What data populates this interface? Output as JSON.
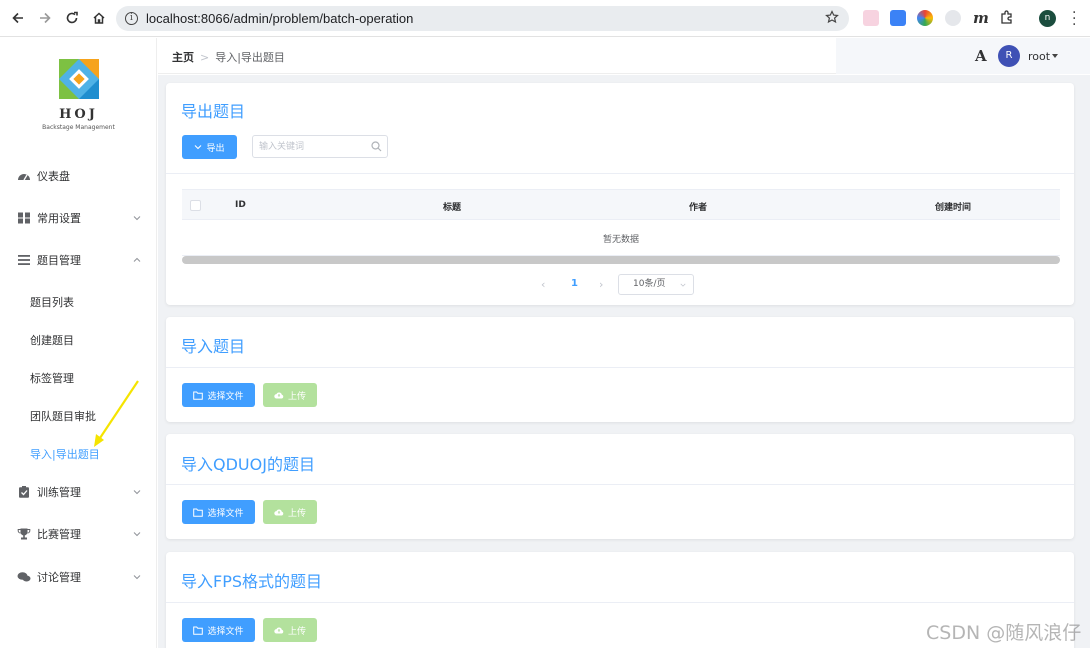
{
  "browser": {
    "url": "localhost:8066/admin/problem/batch-operation",
    "profile_initial": "n"
  },
  "sidebar": {
    "logo_text": "HOJ",
    "logo_subtitle": "Backstage Management",
    "items": [
      {
        "label": "仪表盘",
        "icon": "dashboard-icon"
      },
      {
        "label": "常用设置",
        "icon": "grid-icon"
      },
      {
        "label": "题目管理",
        "icon": "list-icon"
      },
      {
        "label": "训练管理",
        "icon": "clipboard-icon"
      },
      {
        "label": "比赛管理",
        "icon": "trophy-icon"
      },
      {
        "label": "讨论管理",
        "icon": "chat-icon"
      }
    ],
    "sub_items": [
      {
        "label": "题目列表"
      },
      {
        "label": "创建题目"
      },
      {
        "label": "标签管理"
      },
      {
        "label": "团队题目审批"
      },
      {
        "label": "导入|导出题目"
      }
    ]
  },
  "header": {
    "breadcrumb_home": "主页",
    "breadcrumb_current": "导入|导出题目",
    "font_toggle": "A",
    "avatar_initial": "R",
    "username": "root"
  },
  "export_card": {
    "title": "导出题目",
    "export_button": "导出",
    "search_placeholder": "输入关键词",
    "columns": {
      "id": "ID",
      "title": "标题",
      "author": "作者",
      "created": "创建时间"
    },
    "empty_text": "暂无数据",
    "current_page": "1",
    "page_size": "10条/页"
  },
  "import_cards": [
    {
      "title": "导入题目",
      "choose_label": "选择文件",
      "upload_label": "上传"
    },
    {
      "title": "导入QDUOJ的题目",
      "choose_label": "选择文件",
      "upload_label": "上传"
    },
    {
      "title": "导入FPS格式的题目",
      "choose_label": "选择文件",
      "upload_label": "上传"
    }
  ],
  "watermark": "CSDN @随风浪仔",
  "colors": {
    "primary": "#409eff",
    "success_disabled": "#b3e19d",
    "annotation": "#f5e400"
  }
}
